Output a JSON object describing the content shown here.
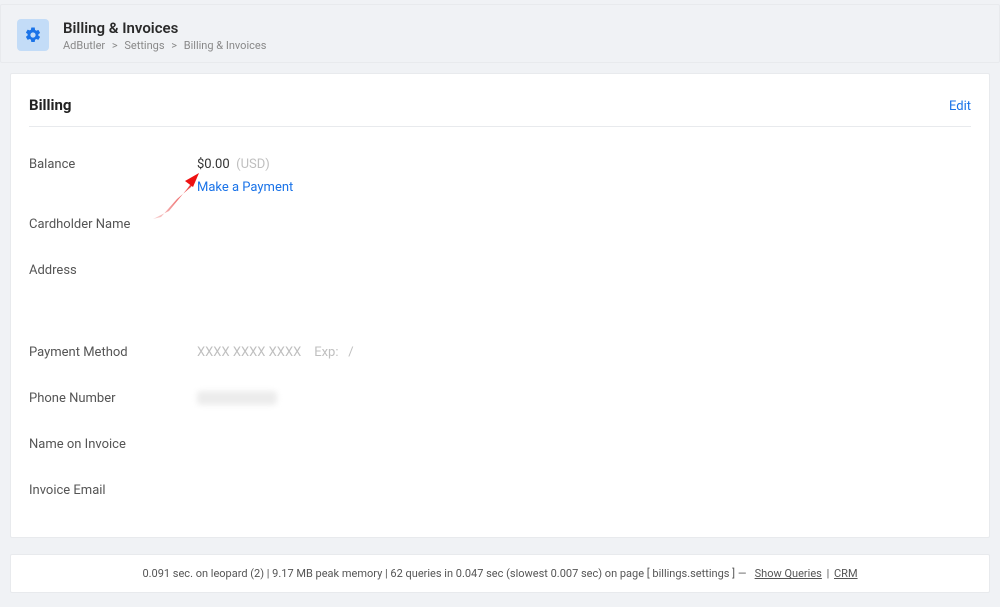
{
  "header": {
    "title": "Billing & Invoices",
    "breadcrumbs": [
      "AdButler",
      "Settings",
      "Billing & Invoices"
    ]
  },
  "billing": {
    "card_title": "Billing",
    "edit_label": "Edit",
    "rows": {
      "balance": {
        "label": "Balance",
        "amount": "$0.00",
        "currency": "(USD)",
        "payment_link": "Make a Payment"
      },
      "cardholder": {
        "label": "Cardholder Name",
        "value": ""
      },
      "address": {
        "label": "Address",
        "value": ""
      },
      "payment_method": {
        "label": "Payment Method",
        "masked": "XXXX XXXX XXXX",
        "exp_label": "Exp:",
        "exp_value": "/"
      },
      "phone": {
        "label": "Phone Number"
      },
      "name_on_invoice": {
        "label": "Name on Invoice",
        "value": ""
      },
      "invoice_email": {
        "label": "Invoice Email",
        "value": ""
      }
    }
  },
  "footer": {
    "stats": "0.091 sec. on leopard (2) | 9.17 MB peak memory | 62 queries in 0.047 sec (slowest 0.007 sec) on page [ billings.settings ] —",
    "show_queries": "Show Queries",
    "crm": "CRM"
  }
}
